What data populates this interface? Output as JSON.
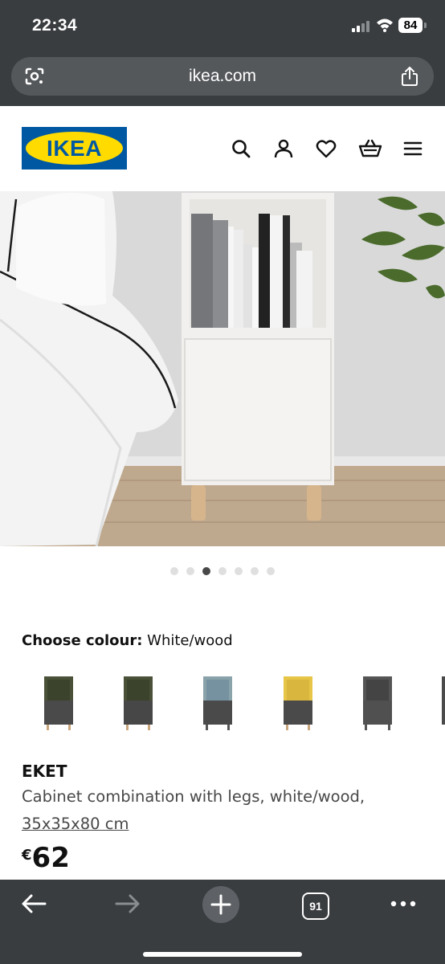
{
  "status": {
    "time": "22:34",
    "battery": "84"
  },
  "browser": {
    "url": "ikea.com",
    "tab_count": "91"
  },
  "brand": {
    "logo_text": "IKEA",
    "blue": "#0058a3",
    "yellow": "#ffdb00"
  },
  "header_icons": [
    "search-icon",
    "account-icon",
    "heart-icon",
    "basket-icon",
    "menu-icon"
  ],
  "gallery": {
    "total_images": 7,
    "active_index": 3
  },
  "colour": {
    "label": "Choose colour:",
    "value": "White/wood",
    "swatches": [
      "dark-green/dark-grey",
      "dark-green/dark-grey",
      "light-blue/dark-grey",
      "yellow/dark-grey",
      "dark-grey"
    ]
  },
  "product": {
    "name": "EKET",
    "description": "Cabinet combination with legs, white/wood,",
    "size": "35x35x80 cm",
    "currency": "€",
    "price": "62"
  }
}
